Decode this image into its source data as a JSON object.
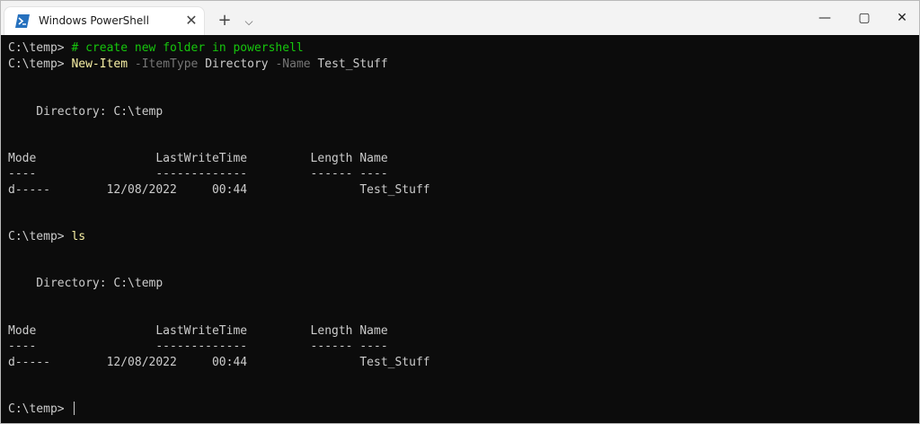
{
  "window": {
    "tab_title": "Windows PowerShell",
    "tab_close": "✕",
    "new_tab": "+",
    "dropdown": "⌵",
    "minimize": "—",
    "maximize": "▢",
    "close": "✕"
  },
  "terminal": {
    "prompt": "C:\\temp>",
    "line1_comment": "# create new folder in powershell",
    "line2_cmd": "New-Item",
    "line2_param1": "-ItemType",
    "line2_val1": "Directory",
    "line2_param2": "-Name",
    "line2_val2": "Test_Stuff",
    "dir_header_1": "    Directory: C:\\temp",
    "col_headers_1": "Mode                 LastWriteTime         Length Name",
    "col_dashes_1": "----                 -------------         ------ ----",
    "row_1": "d-----        12/08/2022     00:44                Test_Stuff",
    "ls_cmd": "ls",
    "dir_header_2": "    Directory: C:\\temp",
    "col_headers_2": "Mode                 LastWriteTime         Length Name",
    "col_dashes_2": "----                 -------------         ------ ----",
    "row_2": "d-----        12/08/2022     00:44                Test_Stuff"
  }
}
